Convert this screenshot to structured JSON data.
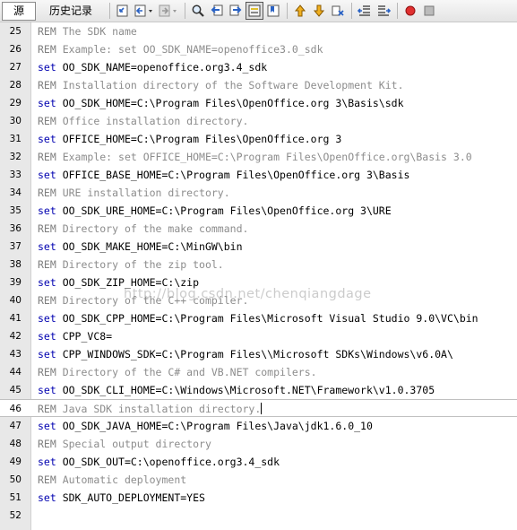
{
  "tabs": [
    {
      "label": "源",
      "active": true
    },
    {
      "label": "历史记录",
      "active": false
    }
  ],
  "toolbar_icons": [
    "last-edit-icon",
    "back-icon",
    "forward-icon",
    "find-icon",
    "find-previous-icon",
    "find-next-icon",
    "toggle-highlight-icon",
    "toggle-bookmark-icon",
    "previous-bookmark-icon",
    "next-bookmark-icon",
    "shift-left-icon",
    "shift-right-icon",
    "record-macro-icon",
    "stop-macro-icon"
  ],
  "colors": {
    "keyword_set": "#0000b0",
    "comment": "#8c8c8c",
    "gutter": "#e8e8e8",
    "macro_record": "#e03030"
  },
  "lines": [
    {
      "num": "25",
      "kw": "REM",
      "text": " The SDK name"
    },
    {
      "num": "26",
      "kw": "REM",
      "text": " Example: set OO_SDK_NAME=openoffice3.0_sdk"
    },
    {
      "num": "27",
      "kw": "set",
      "text": " OO_SDK_NAME=openoffice.org3.4_sdk"
    },
    {
      "num": "28",
      "kw": "REM",
      "text": " Installation directory of the Software Development Kit."
    },
    {
      "num": "29",
      "kw": "set",
      "text": " OO_SDK_HOME=C:\\Program Files\\OpenOffice.org 3\\Basis\\sdk"
    },
    {
      "num": "30",
      "kw": "REM",
      "text": " Office installation directory."
    },
    {
      "num": "31",
      "kw": "set",
      "text": " OFFICE_HOME=C:\\Program Files\\OpenOffice.org 3"
    },
    {
      "num": "32",
      "kw": "REM",
      "text": " Example: set OFFICE_HOME=C:\\Program Files\\OpenOffice.org\\Basis 3.0"
    },
    {
      "num": "33",
      "kw": "set",
      "text": " OFFICE_BASE_HOME=C:\\Program Files\\OpenOffice.org 3\\Basis"
    },
    {
      "num": "34",
      "kw": "REM",
      "text": " URE installation directory."
    },
    {
      "num": "35",
      "kw": "set",
      "text": " OO_SDK_URE_HOME=C:\\Program Files\\OpenOffice.org 3\\URE"
    },
    {
      "num": "36",
      "kw": "REM",
      "text": " Directory of the make command."
    },
    {
      "num": "37",
      "kw": "set",
      "text": " OO_SDK_MAKE_HOME=C:\\MinGW\\bin"
    },
    {
      "num": "38",
      "kw": "REM",
      "text": " Directory of the zip tool."
    },
    {
      "num": "39",
      "kw": "set",
      "text": " OO_SDK_ZIP_HOME=C:\\zip"
    },
    {
      "num": "40",
      "kw": "REM",
      "text": " Directory of the C++ compiler."
    },
    {
      "num": "41",
      "kw": "set",
      "text": " OO_SDK_CPP_HOME=C:\\Program Files\\Microsoft Visual Studio 9.0\\VC\\bin"
    },
    {
      "num": "42",
      "kw": "set",
      "text": " CPP_VC8="
    },
    {
      "num": "43",
      "kw": "set",
      "text": " CPP_WINDOWS_SDK=C:\\Program Files\\\\Microsoft SDKs\\Windows\\v6.0A\\"
    },
    {
      "num": "44",
      "kw": "REM",
      "text": " Directory of the C# and VB.NET compilers."
    },
    {
      "num": "45",
      "kw": "set",
      "text": " OO_SDK_CLI_HOME=C:\\Windows\\Microsoft.NET\\Framework\\v1.0.3705"
    },
    {
      "num": "46",
      "kw": "REM",
      "text": " Java SDK installation directory."
    },
    {
      "num": "47",
      "kw": "set",
      "text": " OO_SDK_JAVA_HOME=C:\\Program Files\\Java\\jdk1.6.0_10"
    },
    {
      "num": "48",
      "kw": "REM",
      "text": " Special output directory"
    },
    {
      "num": "49",
      "kw": "set",
      "text": " OO_SDK_OUT=C:\\openoffice.org3.4_sdk"
    },
    {
      "num": "50",
      "kw": "REM",
      "text": " Automatic deployment"
    },
    {
      "num": "51",
      "kw": "set",
      "text": " SDK_AUTO_DEPLOYMENT=YES"
    },
    {
      "num": "52",
      "kw": "",
      "text": ""
    }
  ],
  "current_line": "46",
  "watermark": "http://blog.csdn.net/chenqiangdage"
}
